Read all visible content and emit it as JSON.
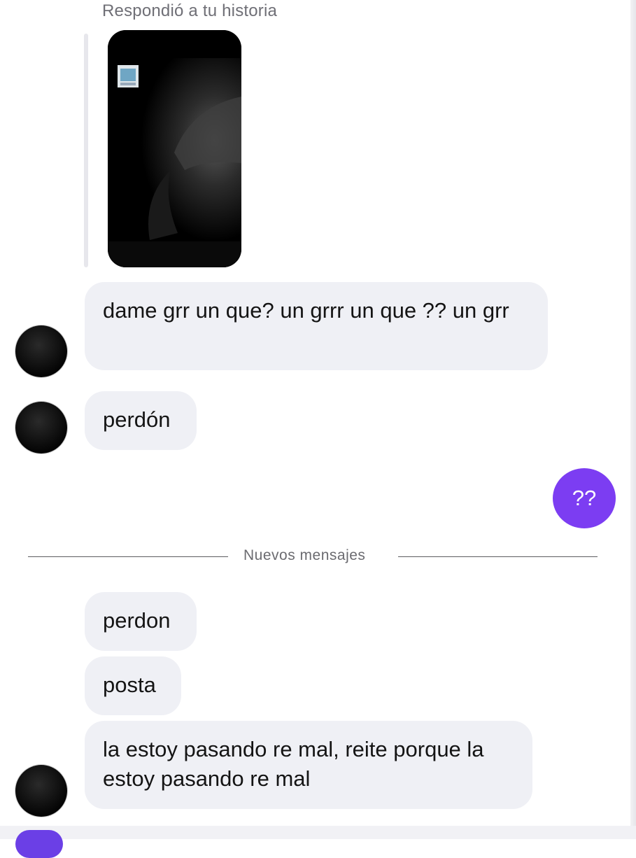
{
  "story_reply": {
    "label": "Respondió a tu historia"
  },
  "messages": [
    {
      "text": "dame grr un que? un grrr un que ?? un grr"
    },
    {
      "text": "perdón"
    },
    {
      "text": "??"
    },
    {
      "text": "perdon"
    },
    {
      "text": "posta"
    },
    {
      "text": "la estoy pasando re mal, reite porque la estoy pasando re mal"
    }
  ],
  "divider": {
    "label": "Nuevos mensajes"
  },
  "colors": {
    "received_bubble": "#eff0f5",
    "sent_bubble": "#7c3df2",
    "background": "#ffffff"
  }
}
